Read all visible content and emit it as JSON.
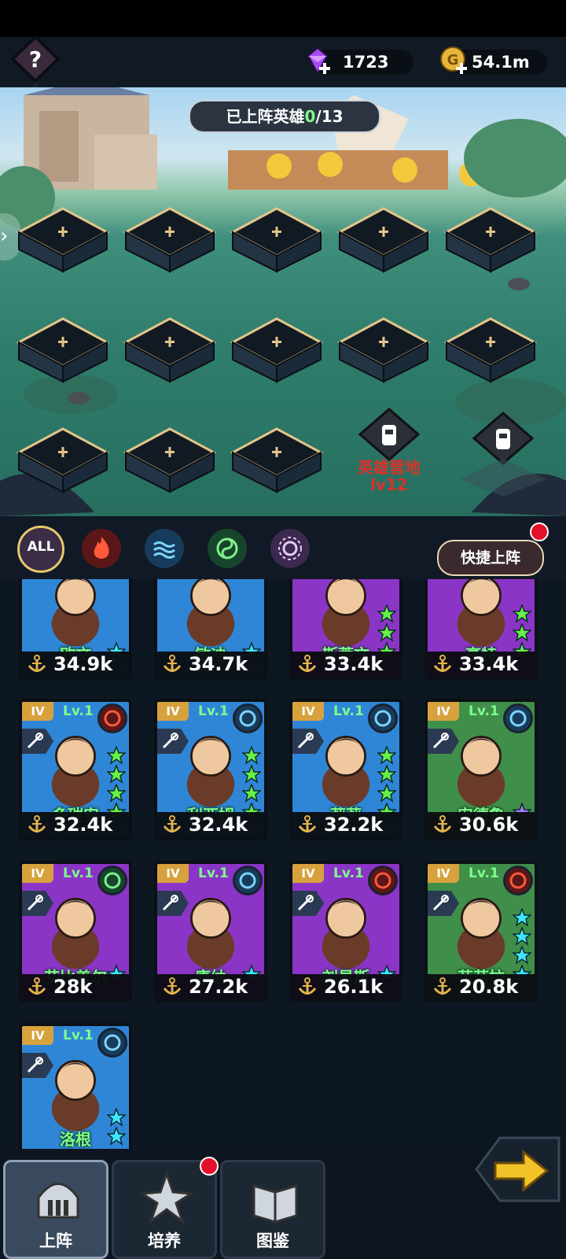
{
  "header": {
    "gems": "1723",
    "gold": "54.1m"
  },
  "battlefield": {
    "deployed_label": "已上阵英雄",
    "deployed_current": "0",
    "deployed_total": "/13",
    "camp_name": "英雄营地",
    "camp_level": "lv12"
  },
  "filters": {
    "all_label": "ALL",
    "items": [
      "all",
      "fire",
      "water",
      "wind",
      "light"
    ],
    "quick_deploy_label": "快捷上阵"
  },
  "heroes": [
    {
      "name": "欧文",
      "power": "34.9k",
      "bg": "blue",
      "stars": 1,
      "star_color": "cyan"
    },
    {
      "name": "敏迪",
      "power": "34.7k",
      "bg": "blue",
      "stars": 1,
      "star_color": "cyan"
    },
    {
      "name": "斯蒂文",
      "power": "33.4k",
      "bg": "purple",
      "stars": 3,
      "star_color": "green"
    },
    {
      "name": "亨特",
      "power": "33.4k",
      "bg": "purple",
      "stars": 3,
      "star_color": "green"
    },
    {
      "name": "多瑞安",
      "power": "32.4k",
      "bg": "blue",
      "rank": "IV",
      "level": "Lv.1",
      "element": "fire",
      "class": "staff",
      "stars": 4,
      "star_color": "green"
    },
    {
      "name": "利亚姆",
      "power": "32.4k",
      "bg": "blue",
      "rank": "IV",
      "level": "Lv.1",
      "element": "water",
      "class": "staff",
      "stars": 4,
      "star_color": "green"
    },
    {
      "name": "莉莉",
      "power": "32.2k",
      "bg": "blue",
      "rank": "IV",
      "level": "Lv.1",
      "element": "water",
      "class": "staff",
      "stars": 4,
      "star_color": "green"
    },
    {
      "name": "安德鲁",
      "power": "30.6k",
      "bg": "green",
      "rank": "IV",
      "level": "Lv.1",
      "element": "water",
      "class": "bow",
      "stars": 1,
      "star_color": "violet"
    },
    {
      "name": "艾比盖尔",
      "power": "28k",
      "bg": "purple",
      "rank": "IV",
      "level": "Lv.1",
      "element": "wind",
      "class": "bow",
      "stars": 1,
      "star_color": "cyan"
    },
    {
      "name": "康纳",
      "power": "27.2k",
      "bg": "purple",
      "rank": "IV",
      "level": "Lv.1",
      "element": "water",
      "class": "sword",
      "stars": 1,
      "star_color": "cyan"
    },
    {
      "name": "刘易斯",
      "power": "26.1k",
      "bg": "purple",
      "rank": "IV",
      "level": "Lv.1",
      "element": "fire",
      "class": "staff",
      "stars": 1,
      "star_color": "cyan"
    },
    {
      "name": "芭芭拉",
      "power": "20.8k",
      "bg": "green",
      "rank": "IV",
      "level": "Lv.1",
      "element": "fire",
      "class": "bow",
      "stars": 4,
      "star_color": "cyan"
    },
    {
      "name": "洛根",
      "power": "",
      "bg": "blue",
      "rank": "IV",
      "level": "Lv.1",
      "element": "water",
      "class": "sword",
      "stars": 2,
      "star_color": "cyan"
    }
  ],
  "nav": {
    "tabs": [
      {
        "label": "上阵",
        "icon": "helmet-icon",
        "active": true
      },
      {
        "label": "培养",
        "icon": "shuriken-icon",
        "active": false,
        "badge": true
      },
      {
        "label": "图鉴",
        "icon": "book-icon",
        "active": false
      }
    ]
  },
  "colors": {
    "name_green": "#7dff8c",
    "card_blue": "#2f86d6",
    "card_purple": "#8b35c7",
    "card_green": "#3f8f4a",
    "gold": "#d7a23d",
    "camp_red": "#d9322b"
  }
}
